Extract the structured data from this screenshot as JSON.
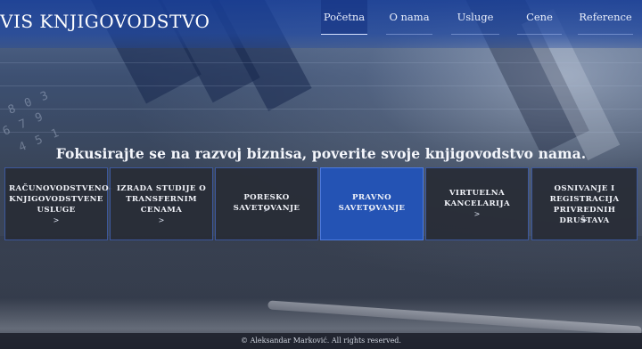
{
  "brand": {
    "logo_text": "VIS KNJIGOVODSTVO"
  },
  "nav": {
    "items": [
      {
        "label": "Početna",
        "active": true
      },
      {
        "label": "O nama",
        "active": false
      },
      {
        "label": "Usluge",
        "active": false
      },
      {
        "label": "Cene",
        "active": false
      },
      {
        "label": "Reference",
        "active": false
      }
    ]
  },
  "hero": {
    "tagline": "Fokusirajte se na razvoj biznisa, poverite svoje knjigovodstvo nama."
  },
  "services": [
    {
      "lines": [
        "RAČUNOVODSTVENO-",
        "KNJIGOVODSTVENE",
        "USLUGE"
      ],
      "arrow": ">",
      "active": false
    },
    {
      "lines": [
        "IZRADA STUDIJE O",
        "TRANSFERNIM",
        "CENAMA"
      ],
      "arrow": ">",
      "active": false
    },
    {
      "lines": [
        "PORESKO SAVETOVANJE"
      ],
      "arrow": ">",
      "active": false
    },
    {
      "lines": [
        "PRAVNO SAVETOVANJE"
      ],
      "arrow": ">",
      "active": true
    },
    {
      "lines": [
        "VIRTUELNA",
        "KANCELARIJA"
      ],
      "arrow": ">",
      "active": false
    },
    {
      "lines": [
        "OSNIVANJE I",
        "REGISTRACIJA",
        "PRIVREDNIH DRUŠTAVA"
      ],
      "arrow": ">",
      "active": false
    }
  ],
  "footer": {
    "copyright": "© Aleksandar Marković. All rights reserved."
  },
  "colors": {
    "header": "#1e46a0",
    "card": "#282c36",
    "card_active": "#2453b4"
  }
}
